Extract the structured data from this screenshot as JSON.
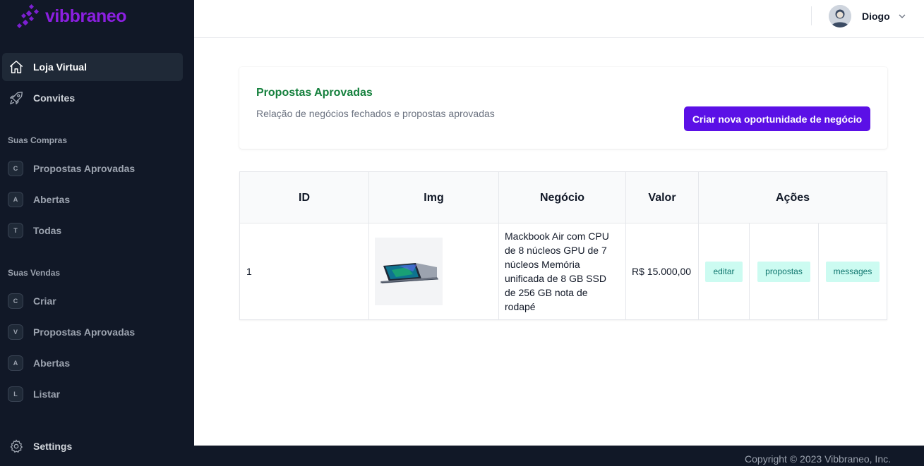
{
  "brand": {
    "name": "vibbraneo",
    "accent": "#8b1fe0"
  },
  "sidebar": {
    "main_items": [
      {
        "label": "Loja Virtual",
        "icon": "home-icon",
        "active": true
      },
      {
        "label": "Convites",
        "icon": "rocket-icon",
        "active": false
      }
    ],
    "sections": [
      {
        "title": "Suas Compras",
        "items": [
          {
            "letter": "C",
            "label": "Propostas Aprovadas"
          },
          {
            "letter": "A",
            "label": "Abertas"
          },
          {
            "letter": "T",
            "label": "Todas"
          }
        ]
      },
      {
        "title": "Suas Vendas",
        "items": [
          {
            "letter": "C",
            "label": "Criar"
          },
          {
            "letter": "V",
            "label": "Propostas Aprovadas"
          },
          {
            "letter": "A",
            "label": "Abertas"
          },
          {
            "letter": "L",
            "label": "Listar"
          }
        ]
      }
    ],
    "settings_label": "Settings"
  },
  "header": {
    "user_name": "Diogo"
  },
  "card": {
    "title": "Propostas Aprovadas",
    "subtitle": "Relação de negócios fechados e propostas aprovadas",
    "button_label": "Criar nova oportunidade de negócio",
    "button_color": "#5b10e6"
  },
  "table": {
    "headers": {
      "id": "ID",
      "img": "Img",
      "negocio": "Negócio",
      "valor": "Valor",
      "acoes": "Ações"
    },
    "rows": [
      {
        "id": "1",
        "negocio": "Mackbook Air com CPU de 8 núcleos GPU de 7 núcleos Memória unificada de 8 GB SSD de 256 GB nota de rodapé",
        "valor": "R$ 15.000,00",
        "actions": {
          "edit": "editar",
          "proposals": "propostas",
          "messages": "messages"
        }
      }
    ]
  },
  "footer": {
    "copyright": "Copyright © 2023 Vibbraneo, Inc."
  }
}
